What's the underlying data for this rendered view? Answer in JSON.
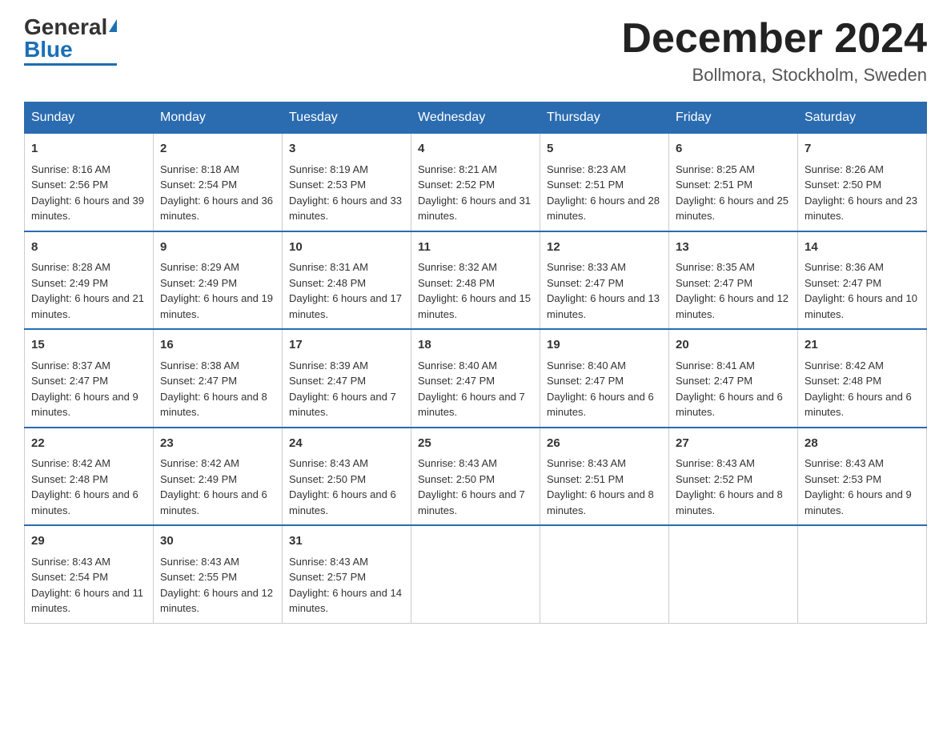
{
  "logo": {
    "text_general": "General",
    "text_blue": "Blue"
  },
  "header": {
    "month": "December 2024",
    "location": "Bollmora, Stockholm, Sweden"
  },
  "days_of_week": [
    "Sunday",
    "Monday",
    "Tuesday",
    "Wednesday",
    "Thursday",
    "Friday",
    "Saturday"
  ],
  "weeks": [
    [
      {
        "day": "1",
        "sunrise": "8:16 AM",
        "sunset": "2:56 PM",
        "daylight": "6 hours and 39 minutes."
      },
      {
        "day": "2",
        "sunrise": "8:18 AM",
        "sunset": "2:54 PM",
        "daylight": "6 hours and 36 minutes."
      },
      {
        "day": "3",
        "sunrise": "8:19 AM",
        "sunset": "2:53 PM",
        "daylight": "6 hours and 33 minutes."
      },
      {
        "day": "4",
        "sunrise": "8:21 AM",
        "sunset": "2:52 PM",
        "daylight": "6 hours and 31 minutes."
      },
      {
        "day": "5",
        "sunrise": "8:23 AM",
        "sunset": "2:51 PM",
        "daylight": "6 hours and 28 minutes."
      },
      {
        "day": "6",
        "sunrise": "8:25 AM",
        "sunset": "2:51 PM",
        "daylight": "6 hours and 25 minutes."
      },
      {
        "day": "7",
        "sunrise": "8:26 AM",
        "sunset": "2:50 PM",
        "daylight": "6 hours and 23 minutes."
      }
    ],
    [
      {
        "day": "8",
        "sunrise": "8:28 AM",
        "sunset": "2:49 PM",
        "daylight": "6 hours and 21 minutes."
      },
      {
        "day": "9",
        "sunrise": "8:29 AM",
        "sunset": "2:49 PM",
        "daylight": "6 hours and 19 minutes."
      },
      {
        "day": "10",
        "sunrise": "8:31 AM",
        "sunset": "2:48 PM",
        "daylight": "6 hours and 17 minutes."
      },
      {
        "day": "11",
        "sunrise": "8:32 AM",
        "sunset": "2:48 PM",
        "daylight": "6 hours and 15 minutes."
      },
      {
        "day": "12",
        "sunrise": "8:33 AM",
        "sunset": "2:47 PM",
        "daylight": "6 hours and 13 minutes."
      },
      {
        "day": "13",
        "sunrise": "8:35 AM",
        "sunset": "2:47 PM",
        "daylight": "6 hours and 12 minutes."
      },
      {
        "day": "14",
        "sunrise": "8:36 AM",
        "sunset": "2:47 PM",
        "daylight": "6 hours and 10 minutes."
      }
    ],
    [
      {
        "day": "15",
        "sunrise": "8:37 AM",
        "sunset": "2:47 PM",
        "daylight": "6 hours and 9 minutes."
      },
      {
        "day": "16",
        "sunrise": "8:38 AM",
        "sunset": "2:47 PM",
        "daylight": "6 hours and 8 minutes."
      },
      {
        "day": "17",
        "sunrise": "8:39 AM",
        "sunset": "2:47 PM",
        "daylight": "6 hours and 7 minutes."
      },
      {
        "day": "18",
        "sunrise": "8:40 AM",
        "sunset": "2:47 PM",
        "daylight": "6 hours and 7 minutes."
      },
      {
        "day": "19",
        "sunrise": "8:40 AM",
        "sunset": "2:47 PM",
        "daylight": "6 hours and 6 minutes."
      },
      {
        "day": "20",
        "sunrise": "8:41 AM",
        "sunset": "2:47 PM",
        "daylight": "6 hours and 6 minutes."
      },
      {
        "day": "21",
        "sunrise": "8:42 AM",
        "sunset": "2:48 PM",
        "daylight": "6 hours and 6 minutes."
      }
    ],
    [
      {
        "day": "22",
        "sunrise": "8:42 AM",
        "sunset": "2:48 PM",
        "daylight": "6 hours and 6 minutes."
      },
      {
        "day": "23",
        "sunrise": "8:42 AM",
        "sunset": "2:49 PM",
        "daylight": "6 hours and 6 minutes."
      },
      {
        "day": "24",
        "sunrise": "8:43 AM",
        "sunset": "2:50 PM",
        "daylight": "6 hours and 6 minutes."
      },
      {
        "day": "25",
        "sunrise": "8:43 AM",
        "sunset": "2:50 PM",
        "daylight": "6 hours and 7 minutes."
      },
      {
        "day": "26",
        "sunrise": "8:43 AM",
        "sunset": "2:51 PM",
        "daylight": "6 hours and 8 minutes."
      },
      {
        "day": "27",
        "sunrise": "8:43 AM",
        "sunset": "2:52 PM",
        "daylight": "6 hours and 8 minutes."
      },
      {
        "day": "28",
        "sunrise": "8:43 AM",
        "sunset": "2:53 PM",
        "daylight": "6 hours and 9 minutes."
      }
    ],
    [
      {
        "day": "29",
        "sunrise": "8:43 AM",
        "sunset": "2:54 PM",
        "daylight": "6 hours and 11 minutes."
      },
      {
        "day": "30",
        "sunrise": "8:43 AM",
        "sunset": "2:55 PM",
        "daylight": "6 hours and 12 minutes."
      },
      {
        "day": "31",
        "sunrise": "8:43 AM",
        "sunset": "2:57 PM",
        "daylight": "6 hours and 14 minutes."
      },
      null,
      null,
      null,
      null
    ]
  ]
}
